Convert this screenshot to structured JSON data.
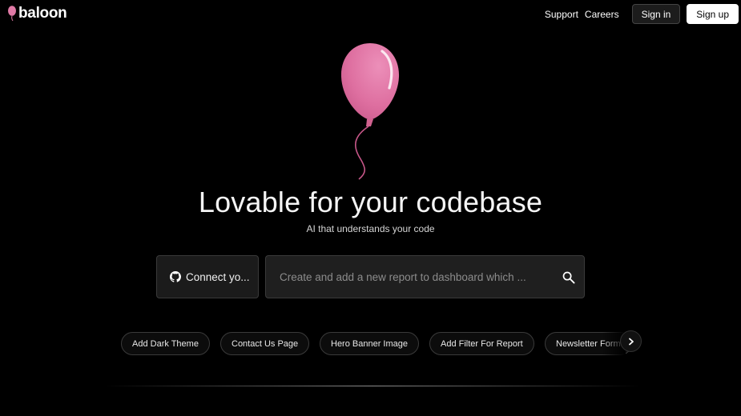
{
  "brand": {
    "name": "baloon",
    "icon": "balloon-icon",
    "accent": "#e07aa6"
  },
  "nav": {
    "support": "Support",
    "careers": "Careers",
    "sign_in": "Sign in",
    "sign_up": "Sign up"
  },
  "hero": {
    "headline": "Lovable for your codebase",
    "subline": "AI that understands your code"
  },
  "connect": {
    "label": "Connect yo...",
    "icon": "github-icon"
  },
  "search": {
    "placeholder": "Create and add a new report to dashboard which ...",
    "icon": "search-icon"
  },
  "suggestions": [
    {
      "label": "Add Dark Theme"
    },
    {
      "label": "Contact Us Page"
    },
    {
      "label": "Hero Banner Image"
    },
    {
      "label": "Add Filter For Report"
    },
    {
      "label": "Newsletter Form"
    }
  ],
  "suggestions_next_icon": "chevron-right-icon"
}
